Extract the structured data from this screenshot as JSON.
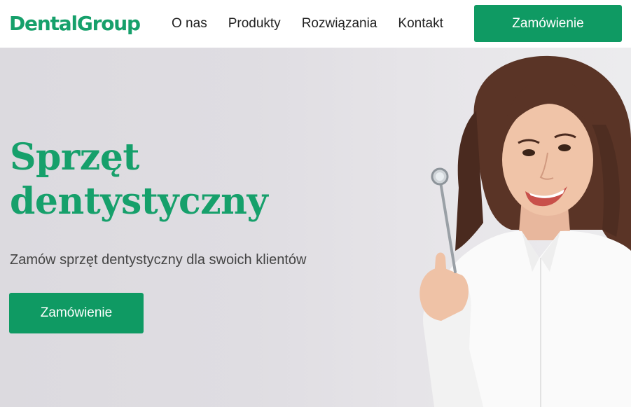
{
  "header": {
    "logo": "DentalGroup",
    "nav": [
      "O nas",
      "Produkty",
      "Rozwiązania",
      "Kontakt"
    ],
    "cta_label": "Zamówienie"
  },
  "hero": {
    "title_line1": "Sprzęt",
    "title_line2": "dentystyczny",
    "subtitle": "Zamów sprzęt dentystyczny dla swoich klientów",
    "cta_label": "Zamówienie",
    "accent_color": "#16a06b",
    "button_color": "#0f9a63"
  }
}
